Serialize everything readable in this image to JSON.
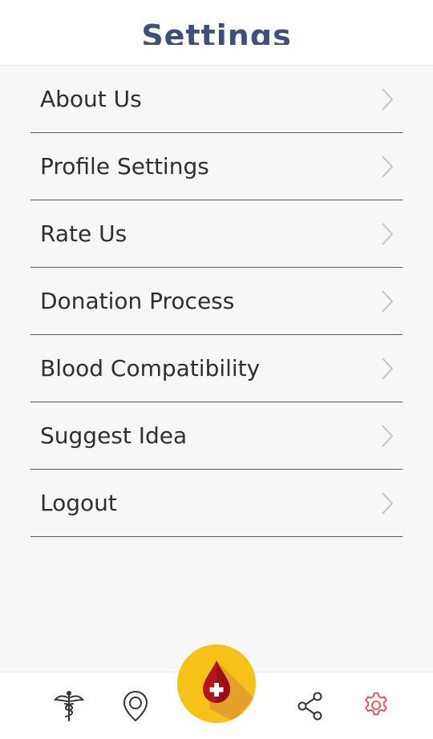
{
  "header": {
    "title": "Settings"
  },
  "menu": {
    "items": [
      {
        "label": "About Us"
      },
      {
        "label": "Profile Settings"
      },
      {
        "label": "Rate Us"
      },
      {
        "label": "Donation Process"
      },
      {
        "label": "Blood Compatibility"
      },
      {
        "label": "Suggest Idea"
      },
      {
        "label": "Logout"
      }
    ]
  },
  "bottom_nav": {
    "items": [
      {
        "icon": "caduceus-icon",
        "active": false
      },
      {
        "icon": "map-pin-icon",
        "active": false
      },
      {
        "icon": "blood-drop-plus-icon",
        "active": false
      },
      {
        "icon": "share-icon",
        "active": false
      },
      {
        "icon": "gear-icon",
        "active": true
      }
    ]
  },
  "colors": {
    "title": "#3f4f78",
    "fab": "#f6c21a",
    "drop": "#b3161b",
    "active_icon": "#e64a5a",
    "inactive_icon": "#333333"
  }
}
